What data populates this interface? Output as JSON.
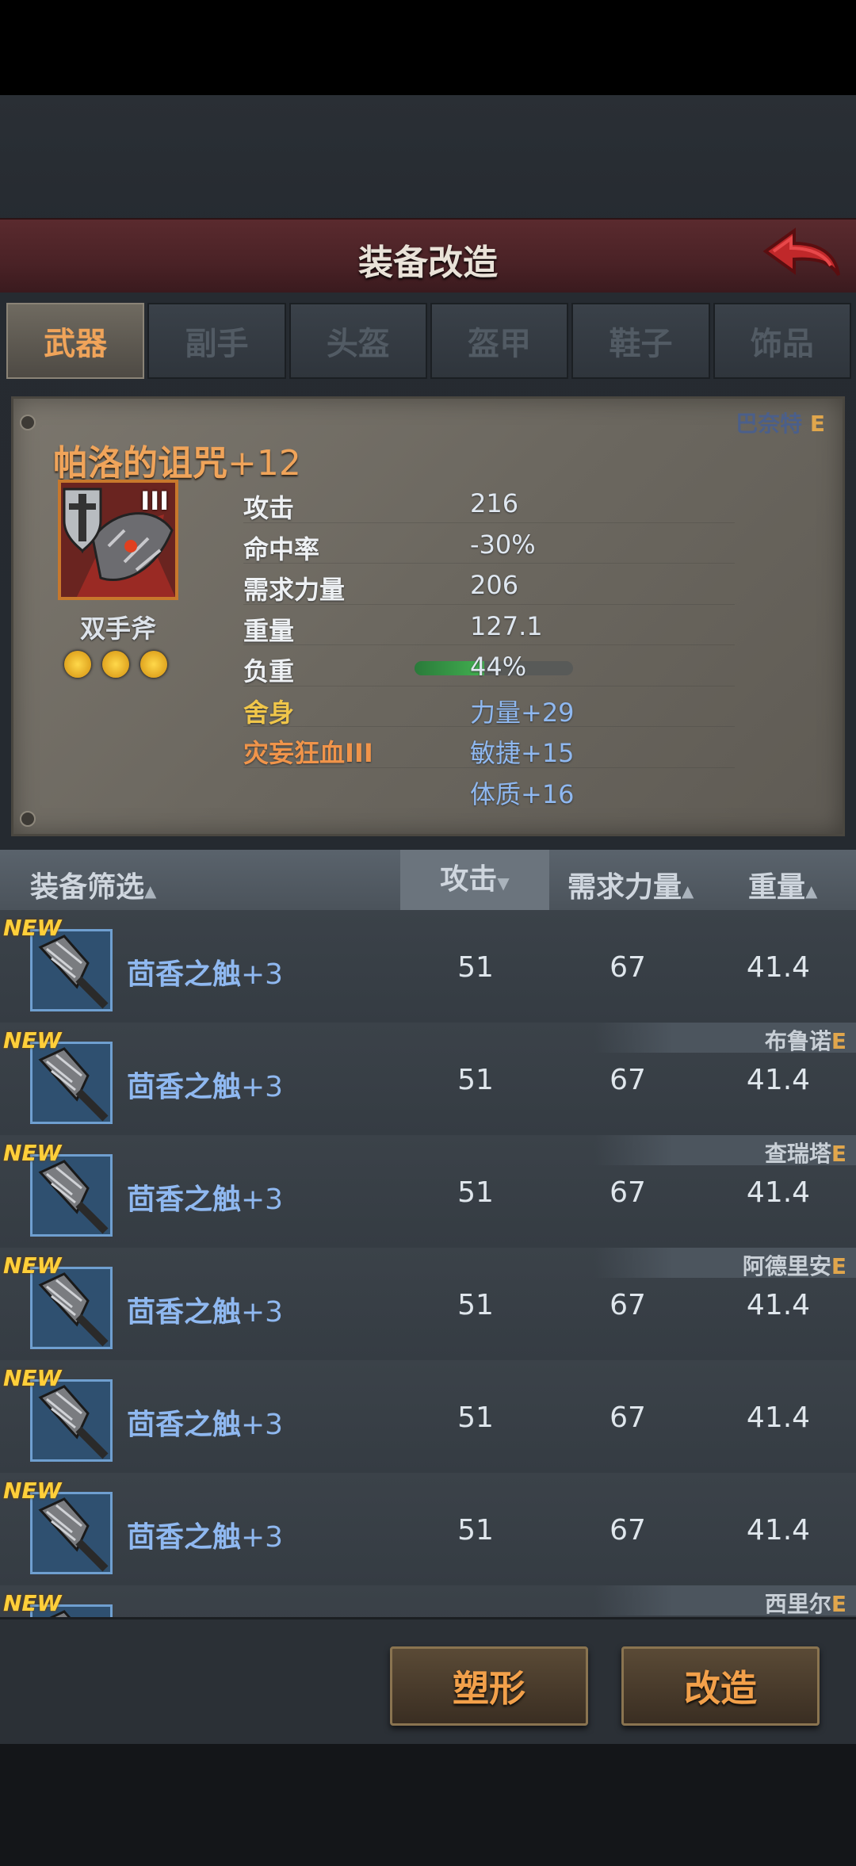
{
  "header": {
    "title": "装备改造"
  },
  "tabs": [
    {
      "label": "武器",
      "active": true
    },
    {
      "label": "副手",
      "active": false
    },
    {
      "label": "头盔",
      "active": false
    },
    {
      "label": "盔甲",
      "active": false
    },
    {
      "label": "鞋子",
      "active": false
    },
    {
      "label": "饰品",
      "active": false
    }
  ],
  "item": {
    "owner": "巴奈特",
    "owner_grade": "E",
    "name": "帕洛的诅咒",
    "plus": "+12",
    "tier": "III",
    "type": "双手斧",
    "gem_count": 3,
    "load_fraction": 0.44,
    "stats": [
      {
        "label": "攻击",
        "value": "216"
      },
      {
        "label": "命中率",
        "value": "-30%"
      },
      {
        "label": "需求力量",
        "value": "206"
      },
      {
        "label": "重量",
        "value": "127.1"
      },
      {
        "label": "负重",
        "value": "44%"
      },
      {
        "label": "舍身",
        "value": "力量+29"
      },
      {
        "label": "灾妄狂血III",
        "value": "敏捷+15"
      },
      {
        "label": "",
        "value": "体质+16"
      }
    ]
  },
  "list_header": {
    "filter": "装备筛选",
    "col_attack": "攻击",
    "col_strength": "需求力量",
    "col_weight": "重量"
  },
  "rows": [
    {
      "badge": "NEW",
      "name": "茴香之触",
      "plus": "+3",
      "attack": "51",
      "strength": "67",
      "weight": "41.4",
      "owner": "",
      "owner_grade": ""
    },
    {
      "badge": "NEW",
      "name": "茴香之触",
      "plus": "+3",
      "attack": "51",
      "strength": "67",
      "weight": "41.4",
      "owner": "布鲁诺",
      "owner_grade": "E"
    },
    {
      "badge": "NEW",
      "name": "茴香之触",
      "plus": "+3",
      "attack": "51",
      "strength": "67",
      "weight": "41.4",
      "owner": "查瑞塔",
      "owner_grade": "E"
    },
    {
      "badge": "NEW",
      "name": "茴香之触",
      "plus": "+3",
      "attack": "51",
      "strength": "67",
      "weight": "41.4",
      "owner": "阿德里安",
      "owner_grade": "E"
    },
    {
      "badge": "NEW",
      "name": "茴香之触",
      "plus": "+3",
      "attack": "51",
      "strength": "67",
      "weight": "41.4",
      "owner": "",
      "owner_grade": ""
    },
    {
      "badge": "NEW",
      "name": "茴香之触",
      "plus": "+3",
      "attack": "51",
      "strength": "67",
      "weight": "41.4",
      "owner": "",
      "owner_grade": ""
    },
    {
      "badge": "NEW",
      "name": "",
      "plus": "",
      "attack": "",
      "strength": "",
      "weight": "",
      "owner": "西里尔",
      "owner_grade": "E"
    }
  ],
  "buttons": {
    "reshape": "塑形",
    "modify": "改造"
  },
  "colors": {
    "accent_orange": "#f0a45a",
    "item_blue": "#8fb8f0",
    "grade_gold": "#e0a64c",
    "header_red": "#5a2a2e"
  }
}
